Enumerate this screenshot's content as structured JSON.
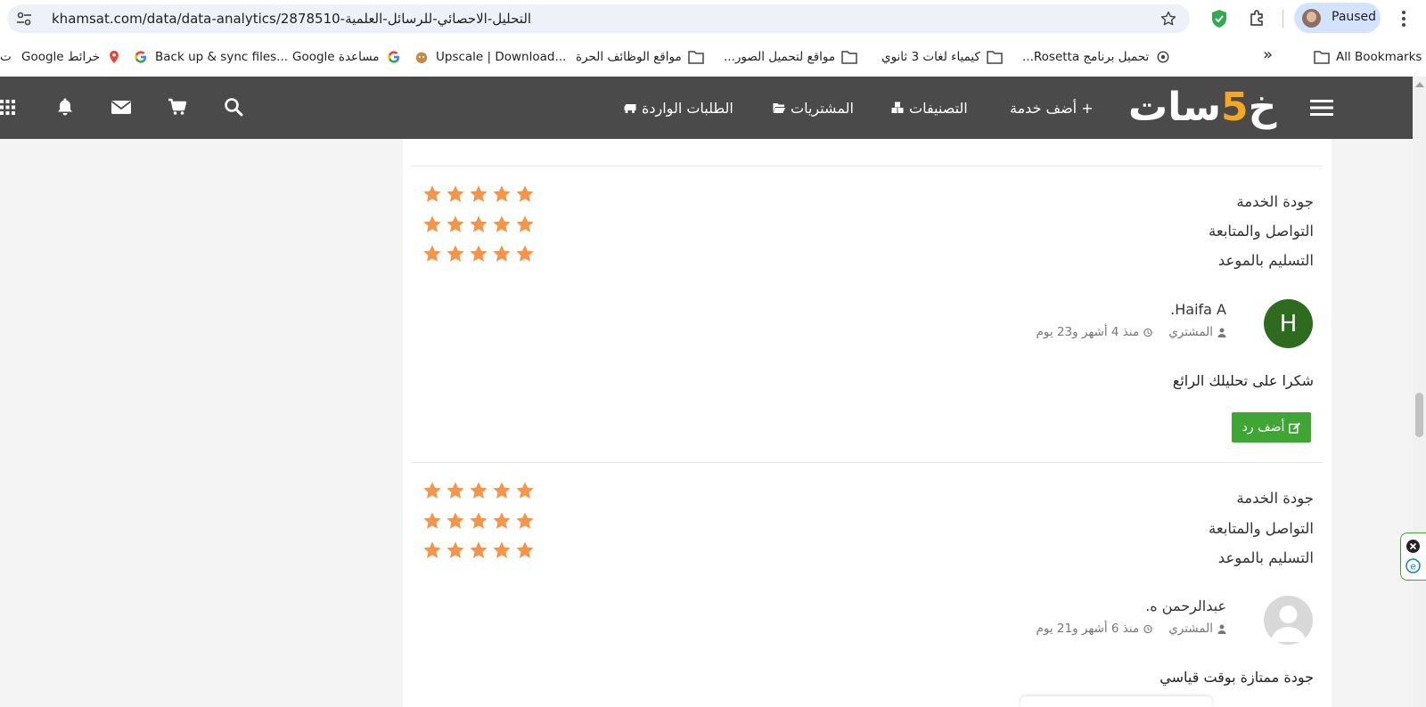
{
  "browser": {
    "url": "khamsat.com/data/data-analytics/2878510-التحليل-الاحصائي-للرسائل-العلمية",
    "profile_label": "Paused"
  },
  "bookmarks": {
    "items": [
      {
        "label": "All Bookmarks"
      },
      {
        "label": "تحميل برنامج Rosetta..."
      },
      {
        "label": "كيمياء لغات 3 ثانوي"
      },
      {
        "label": "مواقع لتحميل الصور..."
      },
      {
        "label": "مواقع الوظائف الحرة"
      },
      {
        "label": "Upscale | Download..."
      },
      {
        "label": "مساعدة Google"
      },
      {
        "label": "Back up & sync files..."
      },
      {
        "label": "خرائط Google"
      },
      {
        "label": "ت"
      }
    ],
    "overflow_label": "»"
  },
  "site": {
    "logo_part1": "خ",
    "logo_five": "5",
    "logo_part2": "سات",
    "nav": {
      "add_service": "+ أضف خدمة",
      "categories": "التصنيفات",
      "purchases": "المشتريات",
      "incoming_requests": "الطلبات الواردة"
    }
  },
  "rating_labels": {
    "quality": "جودة الخدمة",
    "communication": "التواصل والمتابعة",
    "delivery": "التسليم بالموعد"
  },
  "reviews": [
    {
      "user_name": "Haifa A.",
      "avatar_letter": "H",
      "role": "المشتري",
      "time": "منذ 4 أشهر و23 يوم",
      "text": "شكرا على تحليلك الرائع",
      "reply_label": "أضف رد",
      "ratings": {
        "quality": 5,
        "communication": 5,
        "delivery": 5
      }
    },
    {
      "user_name": "عبدالرحمن ه.",
      "role": "المشتري",
      "time": "منذ 6 أشهر و21 يوم",
      "text": "جودة ممتازة بوقت قياسي",
      "ratings": {
        "quality": 5,
        "communication": 5,
        "delivery": 5
      }
    }
  ],
  "colors": {
    "header_bg": "#4a4a4a",
    "star": "#f5954a",
    "accent_green": "#3fa535",
    "logo_accent": "#f5a623"
  }
}
